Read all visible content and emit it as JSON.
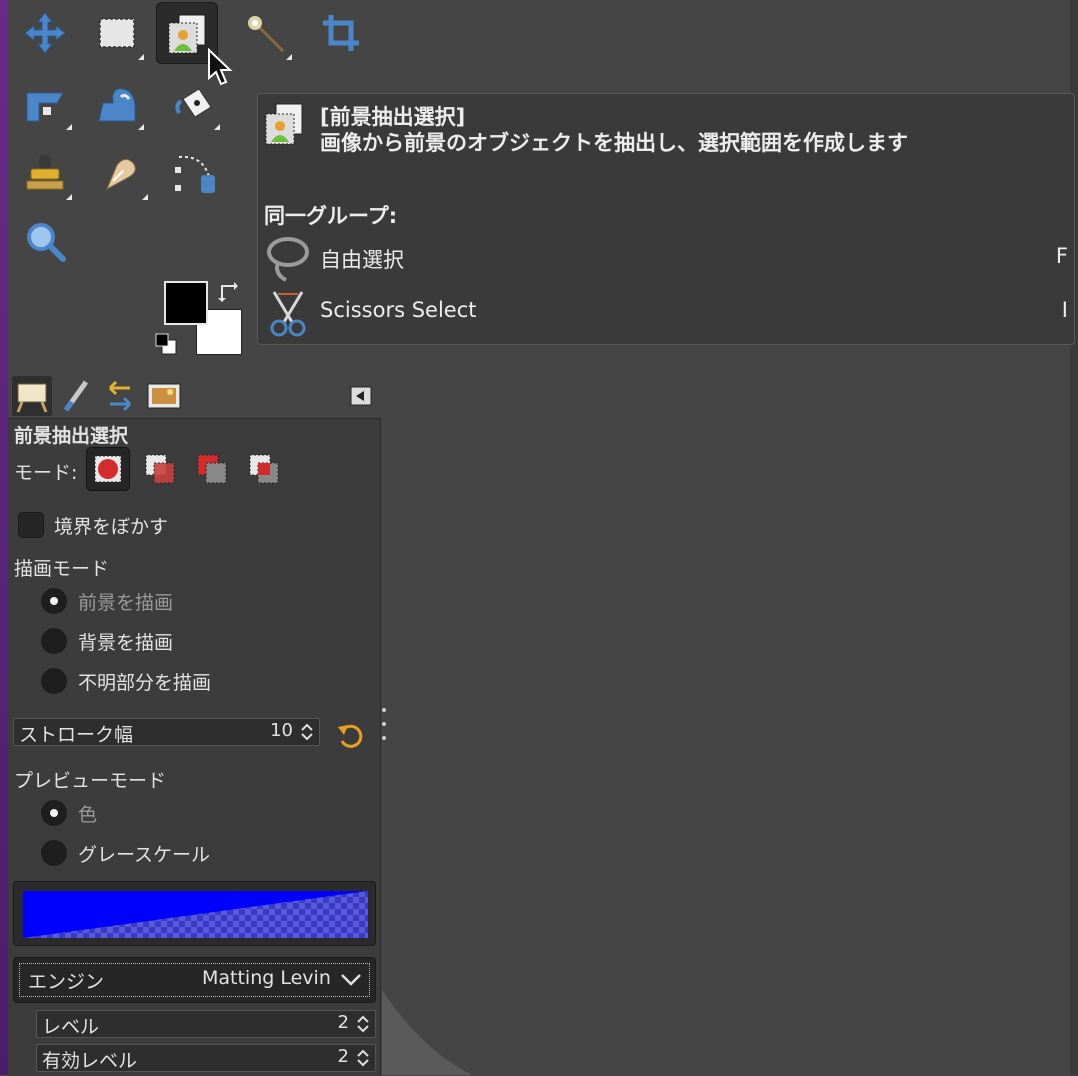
{
  "tooltip": {
    "title": "[前景抽出選択]",
    "description": "画像から前景のオブジェクトを抽出し、選択範囲を作成します",
    "group_header": "同一グループ:",
    "group_items": [
      {
        "label": "自由選択",
        "shortcut": "F",
        "icon": "lasso-icon"
      },
      {
        "label": "Scissors Select",
        "shortcut": "I",
        "icon": "scissors-icon"
      }
    ]
  },
  "options": {
    "title": "前景抽出選択",
    "mode_label": "モード:",
    "feather_label": "境界をぼかす",
    "draw_mode_label": "描画モード",
    "draw_modes": [
      "前景を描画",
      "背景を描画",
      "不明部分を描画"
    ],
    "stroke_label": "ストローク幅",
    "stroke_value": "10",
    "preview_mode_label": "プレビューモード",
    "preview_modes": [
      "色",
      "グレースケール"
    ],
    "engine_label": "エンジン",
    "engine_value": "Matting Levin",
    "level_label": "レベル",
    "level_value": "2",
    "active_level_label": "有効レベル",
    "active_level_value": "2"
  },
  "colors": {
    "preview_color": "#0000ff",
    "foreground": "#000000",
    "background": "#ffffff"
  }
}
